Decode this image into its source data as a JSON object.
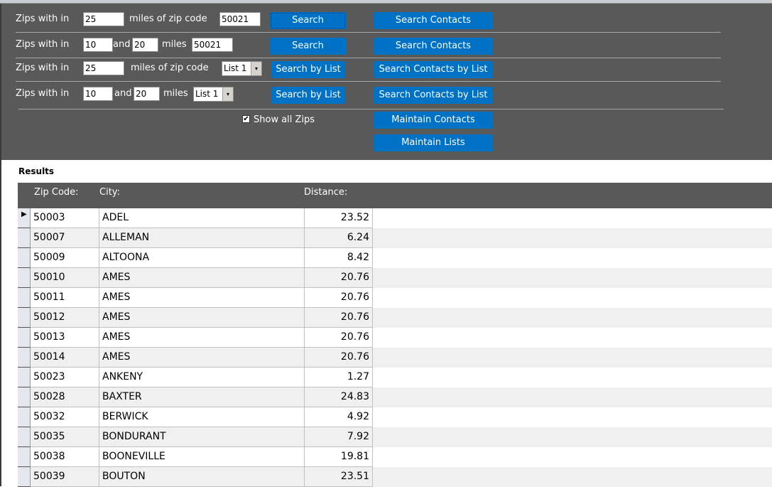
{
  "search_form": {
    "rows": [
      {
        "prefix": "Zips with in",
        "miles": "25",
        "mid_label": "miles of zip code",
        "zip": "50021",
        "search_label": "Search",
        "contacts_label": "Search Contacts"
      },
      {
        "prefix": "Zips with in",
        "from": "10",
        "and_label": "and",
        "to": "20",
        "mid_label": "miles",
        "zip": "50021",
        "search_label": "Search",
        "contacts_label": "Search Contacts"
      },
      {
        "prefix": "Zips with in",
        "miles": "25",
        "mid_label": "miles of zip code",
        "list": "List 1",
        "search_label": "Search by List",
        "contacts_label": "Search Contacts by List"
      },
      {
        "prefix": "Zips with in",
        "from": "10",
        "and_label": "and",
        "to": "20",
        "mid_label": "miles",
        "list": "List 1",
        "search_label": "Search by List",
        "contacts_label": "Search Contacts by List"
      }
    ],
    "show_all_zips": {
      "label": "Show all Zips",
      "checked": true,
      "glyph": "✔"
    },
    "maintain_contacts_label": "Maintain Contacts",
    "maintain_lists_label": "Maintain Lists",
    "dropdown_icon": "▾"
  },
  "results": {
    "title": "Results",
    "columns": [
      "Zip Code:",
      "City:",
      "Distance:"
    ],
    "current_row_icon": "▶",
    "rows": [
      {
        "zip": "50003",
        "city": "ADEL",
        "distance": "23.52"
      },
      {
        "zip": "50007",
        "city": "ALLEMAN",
        "distance": "6.24"
      },
      {
        "zip": "50009",
        "city": "ALTOONA",
        "distance": "8.42"
      },
      {
        "zip": "50010",
        "city": "AMES",
        "distance": "20.76"
      },
      {
        "zip": "50011",
        "city": "AMES",
        "distance": "20.76"
      },
      {
        "zip": "50012",
        "city": "AMES",
        "distance": "20.76"
      },
      {
        "zip": "50013",
        "city": "AMES",
        "distance": "20.76"
      },
      {
        "zip": "50014",
        "city": "AMES",
        "distance": "20.76"
      },
      {
        "zip": "50023",
        "city": "ANKENY",
        "distance": "1.27"
      },
      {
        "zip": "50028",
        "city": "BAXTER",
        "distance": "24.83"
      },
      {
        "zip": "50032",
        "city": "BERWICK",
        "distance": "4.92"
      },
      {
        "zip": "50035",
        "city": "BONDURANT",
        "distance": "7.92"
      },
      {
        "zip": "50038",
        "city": "BOONEVILLE",
        "distance": "19.81"
      },
      {
        "zip": "50039",
        "city": "BOUTON",
        "distance": "23.51"
      }
    ]
  }
}
